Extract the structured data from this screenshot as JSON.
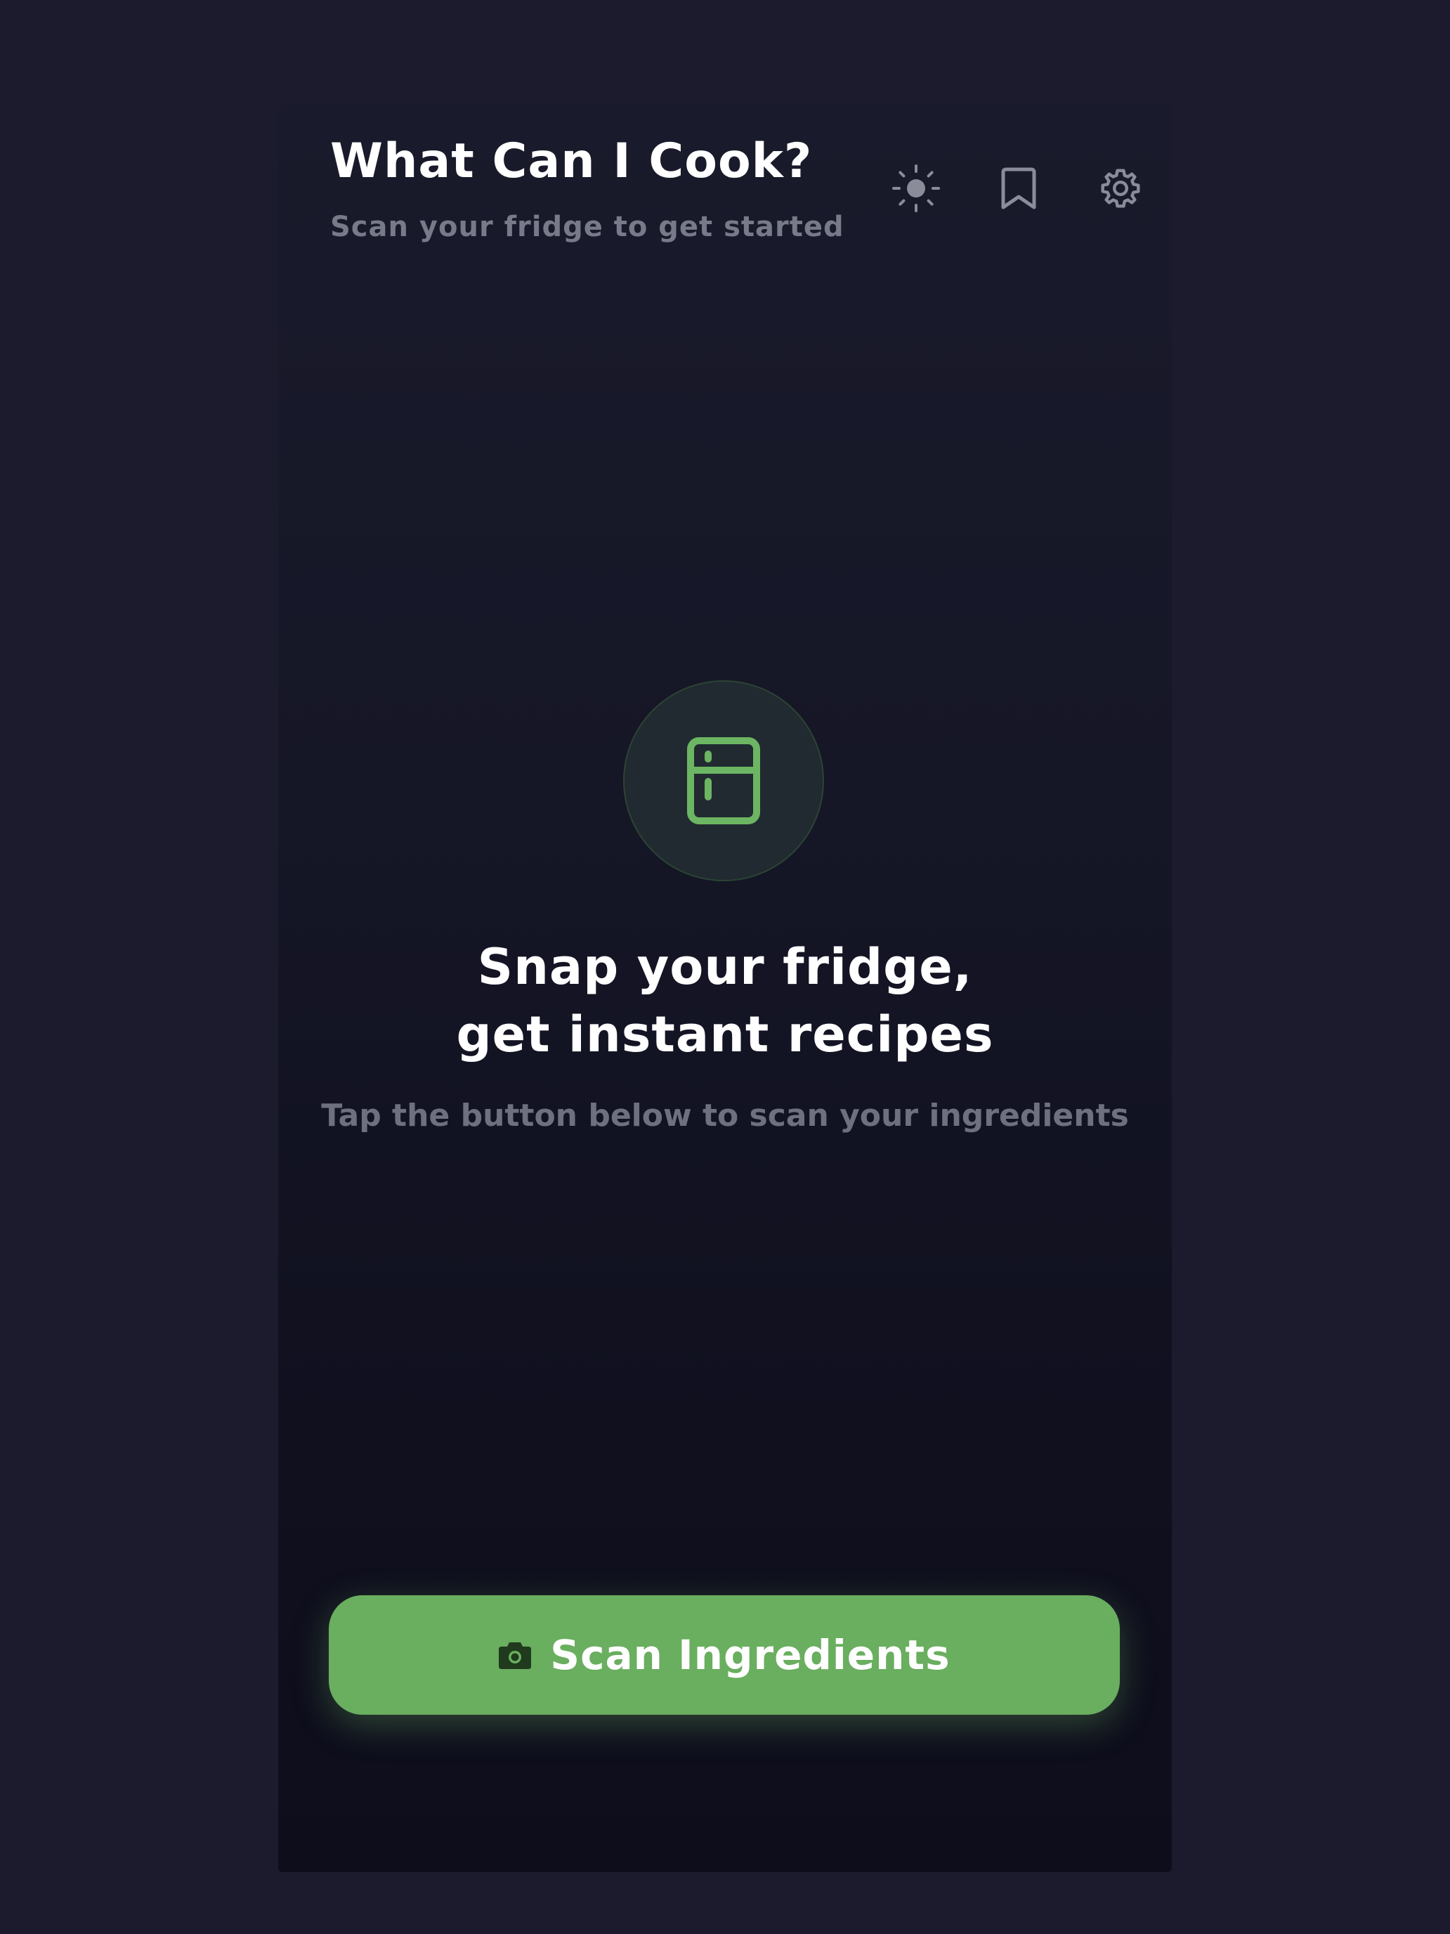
{
  "header": {
    "title": "What Can I Cook?",
    "subtitle": "Scan your fridge to get started"
  },
  "toolbar": {
    "icons": [
      "sun-icon",
      "bookmark-icon",
      "gear-icon"
    ]
  },
  "hero": {
    "icon": "fridge-icon",
    "title_line1": "Snap your fridge,",
    "title_line2": "get instant recipes",
    "subtitle": "Tap the button below to scan your ingredients"
  },
  "scan_button": {
    "label": "Scan Ingredients",
    "icon": "camera-icon"
  },
  "colors": {
    "page_background": "#1b1b2d",
    "accent_green": "#6aae5f",
    "icon_green": "#6cb563",
    "muted_text": "#777a88"
  }
}
